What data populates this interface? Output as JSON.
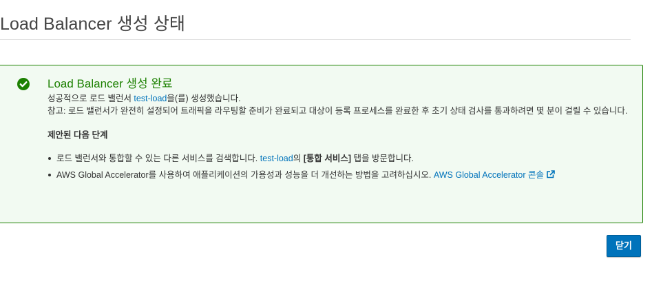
{
  "page": {
    "title": "Load Balancer 생성 상태"
  },
  "notification": {
    "status": "success",
    "icon": "check-circle-icon",
    "heading": "Load Balancer 생성 완료",
    "success_prefix": "성공적으로 로드 밸런서 ",
    "load_balancer_name": "test-load",
    "success_suffix": "을(를) 생성했습니다.",
    "note": "참고: 로드 밸런서가 완전히 설정되어 트래픽을 라우팅할 준비가 완료되고 대상이 등록 프로세스를 완료한 후 초기 상태 검사를 통과하려면 몇 분이 걸릴 수 있습니다.",
    "next_steps_title": "제안된 다음 단계",
    "steps": [
      {
        "before": "로드 밸런서와 통합할 수 있는 다른 서비스를 검색합니다. ",
        "link": "test-load",
        "middle": "의 ",
        "bold": "[통합 서비스]",
        "after": " 탭을 방문합니다."
      },
      {
        "before": "AWS Global Accelerator를 사용하여 애플리케이션의 가용성과 성능을 더 개선하는 방법을 고려하십시오. ",
        "link": "AWS Global Accelerator 콘솔",
        "link_icon": "external-link-icon"
      }
    ]
  },
  "actions": {
    "close_label": "닫기"
  },
  "colors": {
    "success": "#1d8102",
    "panel_background": "#f2faf2",
    "link": "#0073bb",
    "primary_button": "#0073bb"
  }
}
